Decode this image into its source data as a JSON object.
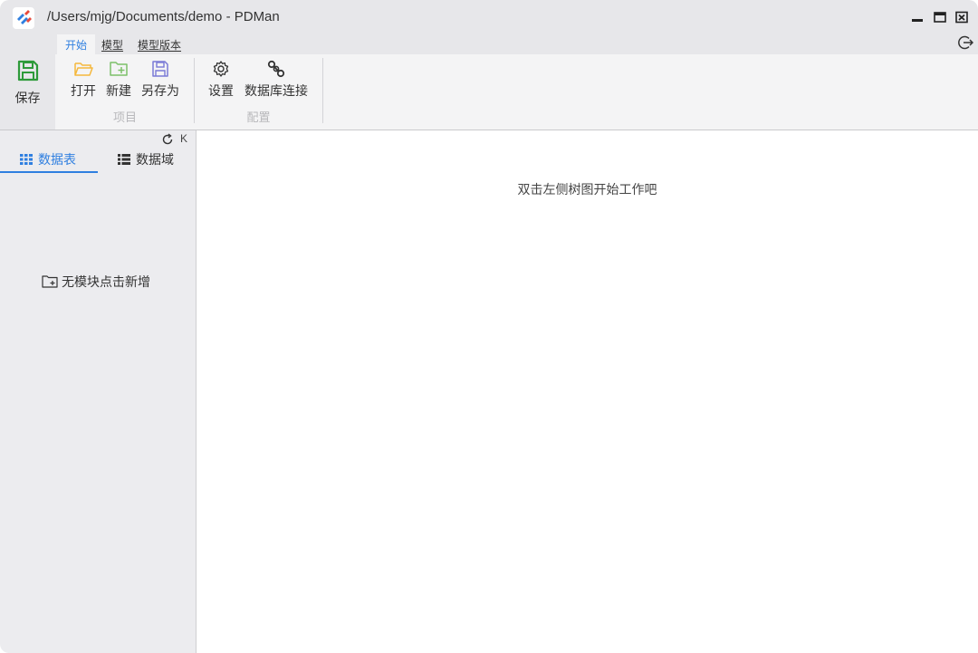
{
  "window": {
    "title": "/Users/mjg/Documents/demo - PDMan"
  },
  "menu": {
    "tabs": [
      {
        "label": "开始",
        "active": true
      },
      {
        "label": "模型",
        "active": false
      },
      {
        "label": "模型版本",
        "active": false
      }
    ]
  },
  "ribbon": {
    "save_label": "保存",
    "project_group": {
      "label": "项目",
      "buttons": [
        {
          "label": "打开",
          "icon": "folder-open-icon"
        },
        {
          "label": "新建",
          "icon": "folder-add-icon"
        },
        {
          "label": "另存为",
          "icon": "save-as-icon"
        }
      ]
    },
    "config_group": {
      "label": "配置",
      "buttons": [
        {
          "label": "设置",
          "icon": "gear-icon"
        },
        {
          "label": "数据库连接",
          "icon": "link-icon"
        }
      ]
    }
  },
  "left_panel": {
    "collapse_label": "K",
    "tabs": [
      {
        "label": "数据表",
        "icon": "grid-icon",
        "active": true
      },
      {
        "label": "数据域",
        "icon": "list-icon",
        "active": false
      }
    ],
    "empty_hint": "无模块点击新增"
  },
  "main": {
    "hint": "双击左侧树图开始工作吧"
  },
  "colors": {
    "accent": "#2f7fe0",
    "save_green": "#2e9a3a",
    "folder_yellow": "#f5b83d",
    "folder_green": "#7cc06a",
    "save_as_purple": "#7a7ad6"
  }
}
